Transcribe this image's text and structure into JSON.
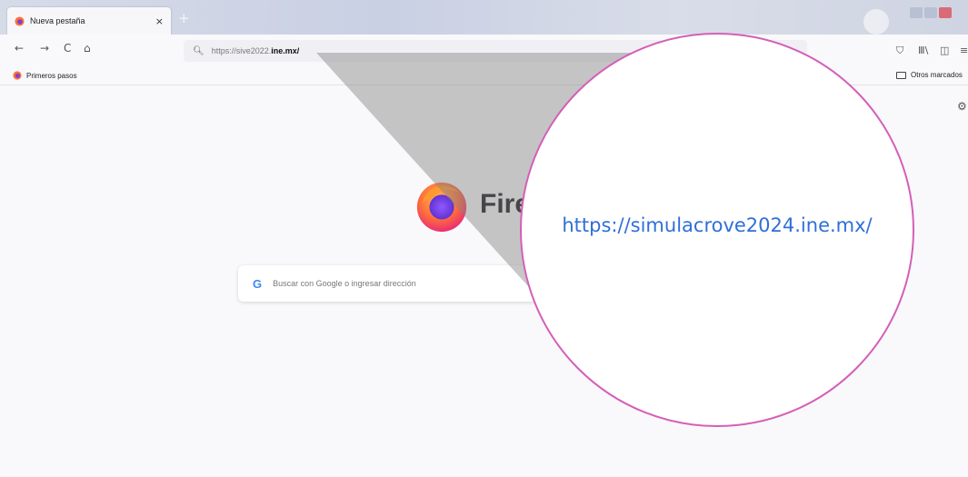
{
  "browser": {
    "tab": {
      "title": "Nueva pestaña",
      "close": "×"
    },
    "new_tab": "+",
    "nav": {
      "back": "←",
      "forward": "→",
      "reload": "C",
      "home": "⌂"
    },
    "url": {
      "prefix": "https://sive2022.",
      "domain": "ine.mx/"
    },
    "toolbar_right": {
      "pocket": "⛉",
      "library": "Ⅲ\\",
      "sidebar": "◫",
      "more": "≡"
    }
  },
  "bookmarks": {
    "first": "Primeros pasos",
    "other": "Otros marcados"
  },
  "newtab": {
    "brand": "Fire",
    "search_placeholder": "Buscar con Google o ingresar dirección",
    "google_glyph": "G",
    "settings_icon": "⚙"
  },
  "magnifier": {
    "url": "https://simulacrove2024.ine.mx/"
  },
  "colors": {
    "magnifier_border": "#d45fb8",
    "magnifier_url": "#2f6fd8"
  }
}
